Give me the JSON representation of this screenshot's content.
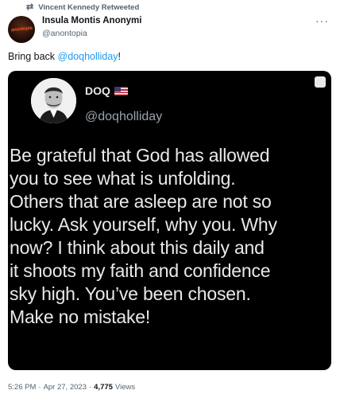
{
  "retweet": {
    "icon": "retweet-icon",
    "label": "Vincent Kennedy Retweeted"
  },
  "author": {
    "name": "Insula Montis Anonymi",
    "handle": "@anontopia",
    "avatar_text": "anontopia"
  },
  "tweet": {
    "text_prefix": "Bring back ",
    "mention": "@doqholliday",
    "text_suffix": "!"
  },
  "embedded": {
    "name": "DOQ",
    "handle": "@doqholliday",
    "lines": [
      "Be grateful that God has allowed",
      "you to see what is unfolding.",
      "Others that are asleep are not so",
      "lucky. Ask yourself, why you. Why",
      "now? I think about this daily and",
      "it shoots my faith and confidence",
      "sky high. You’ve been chosen.",
      "Make no mistake!"
    ]
  },
  "meta": {
    "time": "5:26 PM",
    "sep1": "·",
    "date": "Apr 27, 2023",
    "sep2": "·",
    "views_count": "4,775",
    "views_label": "Views"
  },
  "colors": {
    "accent": "#1d9bf0",
    "secondary_text": "#536471",
    "embed_bg": "#000000"
  }
}
